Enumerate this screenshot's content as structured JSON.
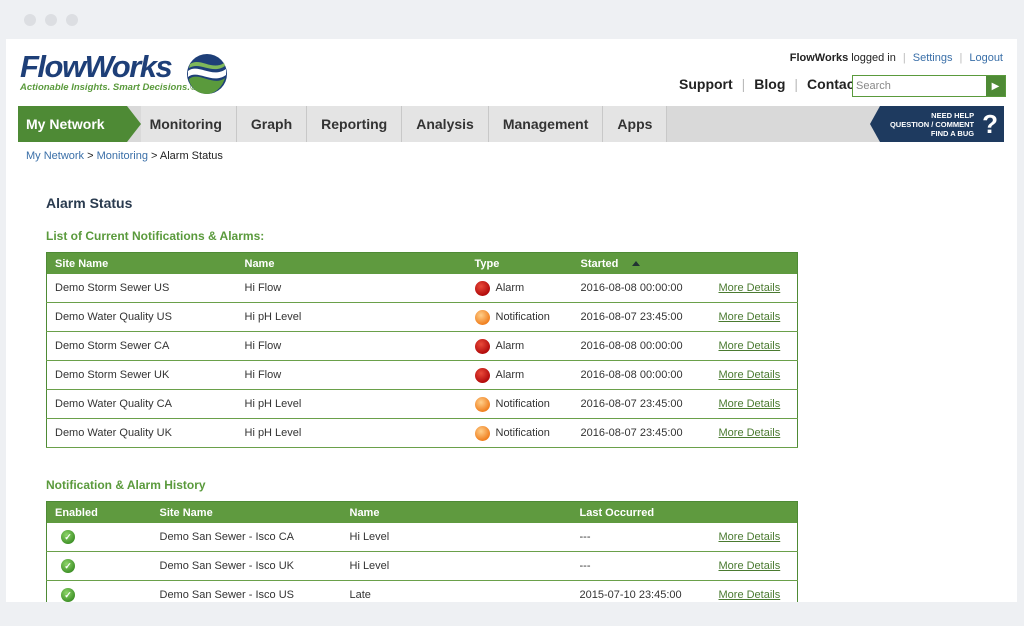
{
  "brand": {
    "name": "FlowWorks",
    "tagline": "Actionable Insights. Smart Decisions.®"
  },
  "account": {
    "user": "FlowWorks",
    "status": "logged in",
    "settings": "Settings",
    "logout": "Logout"
  },
  "mainlinks": {
    "support": "Support",
    "blog": "Blog",
    "contact": "Contact"
  },
  "search": {
    "placeholder": "Search"
  },
  "nav": {
    "active": "My Network",
    "items": [
      "Monitoring",
      "Graph",
      "Reporting",
      "Analysis",
      "Management",
      "Apps"
    ],
    "help": {
      "line1": "NEED HELP",
      "line2": "QUESTION / COMMENT",
      "line3": "FIND A BUG",
      "mark": "?"
    }
  },
  "breadcrumb": {
    "root": "My Network",
    "parent": "Monitoring",
    "current": "Alarm Status"
  },
  "page": {
    "title": "Alarm Status"
  },
  "alarms": {
    "title": "List of Current Notifications & Alarms:",
    "columns": [
      "Site Name",
      "Name",
      "Type",
      "Started"
    ],
    "rows": [
      {
        "site": "Demo Storm Sewer US",
        "name": "Hi Flow",
        "type": "Alarm",
        "started": "2016-08-08 00:00:00",
        "link": "More Details"
      },
      {
        "site": "Demo Water Quality US",
        "name": "Hi pH Level",
        "type": "Notification",
        "started": "2016-08-07 23:45:00",
        "link": "More Details"
      },
      {
        "site": "Demo Storm Sewer CA",
        "name": "Hi Flow",
        "type": "Alarm",
        "started": "2016-08-08 00:00:00",
        "link": "More Details"
      },
      {
        "site": "Demo Storm Sewer UK",
        "name": "Hi Flow",
        "type": "Alarm",
        "started": "2016-08-08 00:00:00",
        "link": "More Details"
      },
      {
        "site": "Demo Water Quality CA",
        "name": "Hi pH Level",
        "type": "Notification",
        "started": "2016-08-07 23:45:00",
        "link": "More Details"
      },
      {
        "site": "Demo Water Quality UK",
        "name": "Hi pH Level",
        "type": "Notification",
        "started": "2016-08-07 23:45:00",
        "link": "More Details"
      }
    ]
  },
  "history": {
    "title": "Notification & Alarm History",
    "columns": [
      "Enabled",
      "Site Name",
      "Name",
      "Last Occurred"
    ],
    "rows": [
      {
        "site": "Demo San Sewer - Isco CA",
        "name": "Hi Level",
        "last": "---",
        "link": "More Details"
      },
      {
        "site": "Demo San Sewer - Isco UK",
        "name": "Hi Level",
        "last": "---",
        "link": "More Details"
      },
      {
        "site": "Demo San Sewer - Isco US",
        "name": "Late",
        "last": "2015-07-10 23:45:00",
        "link": "More Details"
      }
    ]
  },
  "colors": {
    "brand_green": "#4e8a35",
    "brand_navy": "#1e3f78",
    "alarm": "#c4161c",
    "notification": "#f39a33"
  }
}
